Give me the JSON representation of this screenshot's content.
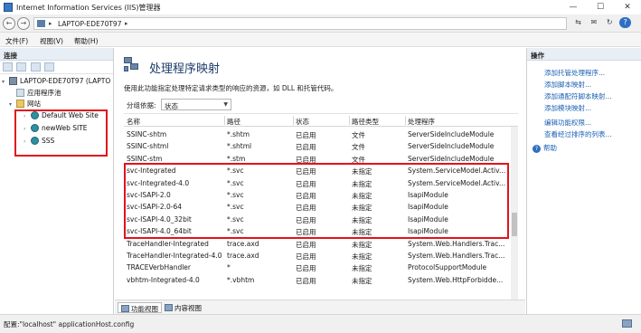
{
  "window": {
    "title": "Internet Information Services (IIS)管理器",
    "min": "—",
    "max": "☐",
    "close": "✕"
  },
  "address": {
    "back": "←",
    "forward": "→",
    "separator": "▸",
    "host": "LAPTOP-EDE70T97",
    "tools": [
      "⇆",
      "✉",
      "↻"
    ],
    "help": "?"
  },
  "menu": [
    "文件(F)",
    "视图(V)",
    "帮助(H)"
  ],
  "connections": {
    "header": "连接",
    "tree": [
      {
        "toggle": "▾",
        "label": "LAPTOP-EDE70T97 (LAPTO",
        "icon": "server-icon"
      },
      {
        "toggle": "",
        "label": "应用程序池",
        "icon": "app-pool-icon"
      },
      {
        "toggle": "▾",
        "label": "网站",
        "icon": "sites-folder-icon"
      },
      {
        "toggle": "›",
        "label": "Default Web Site",
        "icon": "globe-icon"
      },
      {
        "toggle": "›",
        "label": "newWeb SITE",
        "icon": "globe-icon"
      },
      {
        "toggle": "›",
        "label": "SSS",
        "icon": "globe-icon"
      }
    ]
  },
  "feature": {
    "title": "处理程序映射",
    "description": "使用此功能指定处理特定请求类型的响应的资源，如 DLL 和托管代码。",
    "group_label": "分组依据:",
    "group_value": "状态",
    "columns": [
      "名称",
      "路径",
      "状态",
      "路径类型",
      "处理程序"
    ],
    "rows": [
      [
        "SSINC-shtm",
        "*.shtm",
        "已启用",
        "文件",
        "ServerSideIncludeModule"
      ],
      [
        "SSINC-shtml",
        "*.shtml",
        "已启用",
        "文件",
        "ServerSideIncludeModule"
      ],
      [
        "SSINC-stm",
        "*.stm",
        "已启用",
        "文件",
        "ServerSideIncludeModule"
      ],
      [
        "svc-Integrated",
        "*.svc",
        "已启用",
        "未指定",
        "System.ServiceModel.Activ..."
      ],
      [
        "svc-Integrated-4.0",
        "*.svc",
        "已启用",
        "未指定",
        "System.ServiceModel.Activ..."
      ],
      [
        "svc-ISAPI-2.0",
        "*.svc",
        "已启用",
        "未指定",
        "IsapiModule"
      ],
      [
        "svc-ISAPI-2.0-64",
        "*.svc",
        "已启用",
        "未指定",
        "IsapiModule"
      ],
      [
        "svc-ISAPI-4.0_32bit",
        "*.svc",
        "已启用",
        "未指定",
        "IsapiModule"
      ],
      [
        "svc-ISAPI-4.0_64bit",
        "*.svc",
        "已启用",
        "未指定",
        "IsapiModule"
      ],
      [
        "TraceHandler-Integrated",
        "trace.axd",
        "已启用",
        "未指定",
        "System.Web.Handlers.Trac..."
      ],
      [
        "TraceHandler-Integrated-4.0",
        "trace.axd",
        "已启用",
        "未指定",
        "System.Web.Handlers.Trac..."
      ],
      [
        "TRACEVerbHandler",
        "*",
        "已启用",
        "未指定",
        "ProtocolSupportModule"
      ],
      [
        "vbhtm-Integrated-4.0",
        "*.vbhtm",
        "已启用",
        "未指定",
        "System.Web.HttpForbidde..."
      ]
    ]
  },
  "viewtabs": [
    "功能视图",
    "内容视图"
  ],
  "actions": {
    "header": "操作",
    "items": [
      "添加托管处理程序...",
      "添加脚本映射...",
      "添加通配符脚本映射...",
      "添加模块映射...",
      "编辑功能权限...",
      "查看经过排序的列表..."
    ],
    "help": "帮助",
    "help_glyph": "?"
  },
  "status": "配置:\"localhost\" applicationHost.config"
}
